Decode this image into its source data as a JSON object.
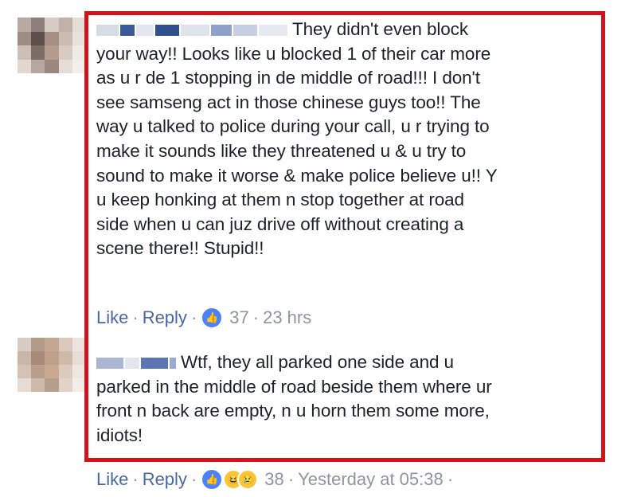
{
  "comments": [
    {
      "lines": [
        "They didn't even block",
        "your way!! Looks like u blocked 1 of their car more",
        "as u r de 1 stopping in de middle of road!!! I don't",
        "see samseng act in those chinese guys too!! The",
        "way u talked to police during your call, u r trying to",
        "make it sounds like they threatened u & u try to",
        "sound to make it worse & make police believe u!! Y",
        "u keep honking at them n stop together at road",
        "side when u can juz drive off without creating a",
        "scene there!! Stupid!!"
      ],
      "like_label": "Like",
      "reply_label": "Reply",
      "reaction_count": "37",
      "timestamp": "23 hrs"
    },
    {
      "lines": [
        "Wtf, they all parked one side and u",
        "parked in the middle of road beside them where ur",
        "front n back are empty, n u horn them some more,",
        "idiots!"
      ],
      "like_label": "Like",
      "reply_label": "Reply",
      "reaction_count": "38",
      "timestamp": "Yesterday at 05:38"
    }
  ],
  "colors": {
    "highlight_border": "#d2131c",
    "link": "#4b67a1",
    "meta_text": "#90949c",
    "like_reaction": "#4c82f7"
  },
  "icons": [
    "like-reaction-icon",
    "haha-reaction-icon",
    "sad-reaction-icon",
    "blurred-avatar"
  ]
}
